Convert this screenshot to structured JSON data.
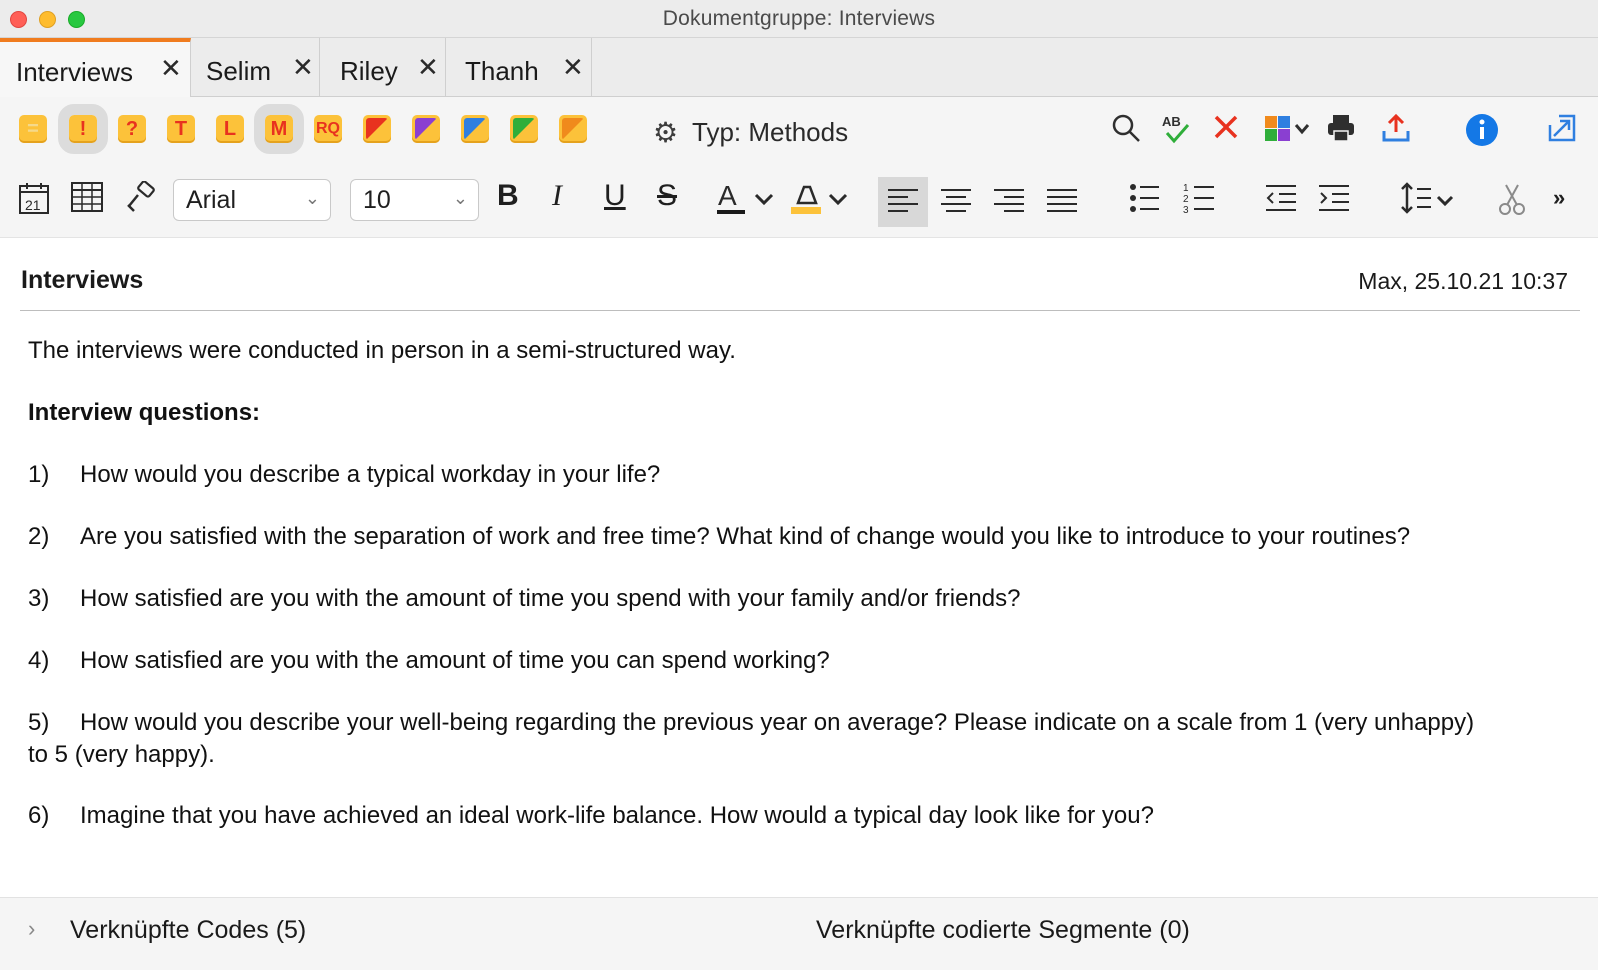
{
  "window": {
    "title": "Dokumentgruppe: Interviews"
  },
  "tabs": [
    {
      "label": "Interviews",
      "close": "✕",
      "active": true
    },
    {
      "label": "Selim",
      "close": "✕",
      "active": false
    },
    {
      "label": "Riley",
      "close": "✕",
      "active": false
    },
    {
      "label": "Thanh",
      "close": "✕",
      "active": false
    }
  ],
  "memo_toolbar": {
    "memo_types": [
      {
        "icon": "memo-icon",
        "glyph": "="
      },
      {
        "icon": "important-memo-icon",
        "glyph": "!"
      },
      {
        "icon": "question-memo-icon",
        "glyph": "?"
      },
      {
        "icon": "theory-memo-icon",
        "glyph": "T"
      },
      {
        "icon": "literature-memo-icon",
        "glyph": "L"
      },
      {
        "icon": "methods-memo-icon",
        "glyph": "M"
      },
      {
        "icon": "research-question-memo-icon",
        "glyph": "RQ"
      },
      {
        "icon": "red-memo-icon",
        "glyph": "",
        "color": "#e8321f"
      },
      {
        "icon": "purple-memo-icon",
        "glyph": "",
        "color": "#8a3fd1"
      },
      {
        "icon": "blue-memo-icon",
        "glyph": "",
        "color": "#2f7fe0"
      },
      {
        "icon": "green-memo-icon",
        "glyph": "",
        "color": "#2fae3a"
      },
      {
        "icon": "orange-memo-icon",
        "glyph": "",
        "color": "#f08a1c"
      }
    ],
    "type_label": "Typ: Methods"
  },
  "format_toolbar": {
    "font": "Arial",
    "size": "10",
    "bold": "B",
    "italic": "I",
    "underline": "U",
    "strike": "S",
    "more": "»"
  },
  "document": {
    "title": "Interviews",
    "meta": "Max, 25.10.21 10:37",
    "intro": "The interviews were conducted in person in a semi-structured way.",
    "heading": "Interview questions:",
    "questions": [
      {
        "num": "1)",
        "text": "How would you describe a typical workday in your life?"
      },
      {
        "num": "2)",
        "text": "Are you satisfied with the separation of work and free time? What kind of change would you like to introduce to your routines?"
      },
      {
        "num": "3)",
        "text": "How satisfied are you with the amount of time you spend with your family and/or friends?"
      },
      {
        "num": "4)",
        "text": "How satisfied are you with the amount of time you can spend working?"
      },
      {
        "num": "5)",
        "text": "How would you describe your well-being regarding the previous year on average? Please indicate on a scale from 1 (very unhappy) to 5 (very happy)."
      },
      {
        "num": "6)",
        "text": "Imagine that you have achieved an ideal work-life balance. How would a typical day look like for you?"
      }
    ]
  },
  "footer": {
    "linked_codes": "Verknüpfte Codes (5)",
    "linked_segments": "Verknüpfte codierte Segmente (0)"
  },
  "colors": {
    "accent_tab": "#f07c1f",
    "memo_yellow": "#fcc23a",
    "memo_red_text": "#e8321f",
    "info_blue": "#1478e6"
  }
}
